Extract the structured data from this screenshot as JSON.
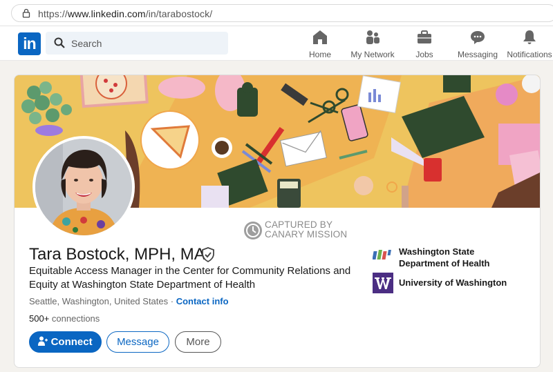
{
  "browser": {
    "url_prefix": "https://",
    "url_domain": "www.linkedin.com",
    "url_path": "/in/tarabostock/"
  },
  "nav": {
    "logo": "in",
    "search_placeholder": "Search",
    "items": [
      {
        "label": "Home",
        "icon": "home-icon"
      },
      {
        "label": "My Network",
        "icon": "network-icon"
      },
      {
        "label": "Jobs",
        "icon": "briefcase-icon"
      },
      {
        "label": "Messaging",
        "icon": "messaging-icon"
      },
      {
        "label": "Notifications",
        "icon": "bell-icon"
      }
    ]
  },
  "watermark": {
    "line1": "CAPTURED BY",
    "line2": "CANARY MISSION"
  },
  "profile": {
    "name": "Tara Bostock, MPH, MA",
    "headline": "Equitable Access Manager in the Center for Community Relations and Equity at Washington State Department of Health",
    "location": "Seattle, Washington, United States",
    "separator": " · ",
    "contact_info": "Contact info",
    "connections_count": "500+",
    "connections_label": " connections",
    "organizations": [
      {
        "line1": "Washington State",
        "line2": "Department of Health"
      },
      {
        "line1": "University of Washington",
        "line2": ""
      }
    ]
  },
  "actions": {
    "connect": "Connect",
    "message": "Message",
    "more": "More"
  },
  "colors": {
    "brand": "#0a66c2",
    "banner": "#eec45e",
    "uw_purple": "#4b2e83"
  }
}
